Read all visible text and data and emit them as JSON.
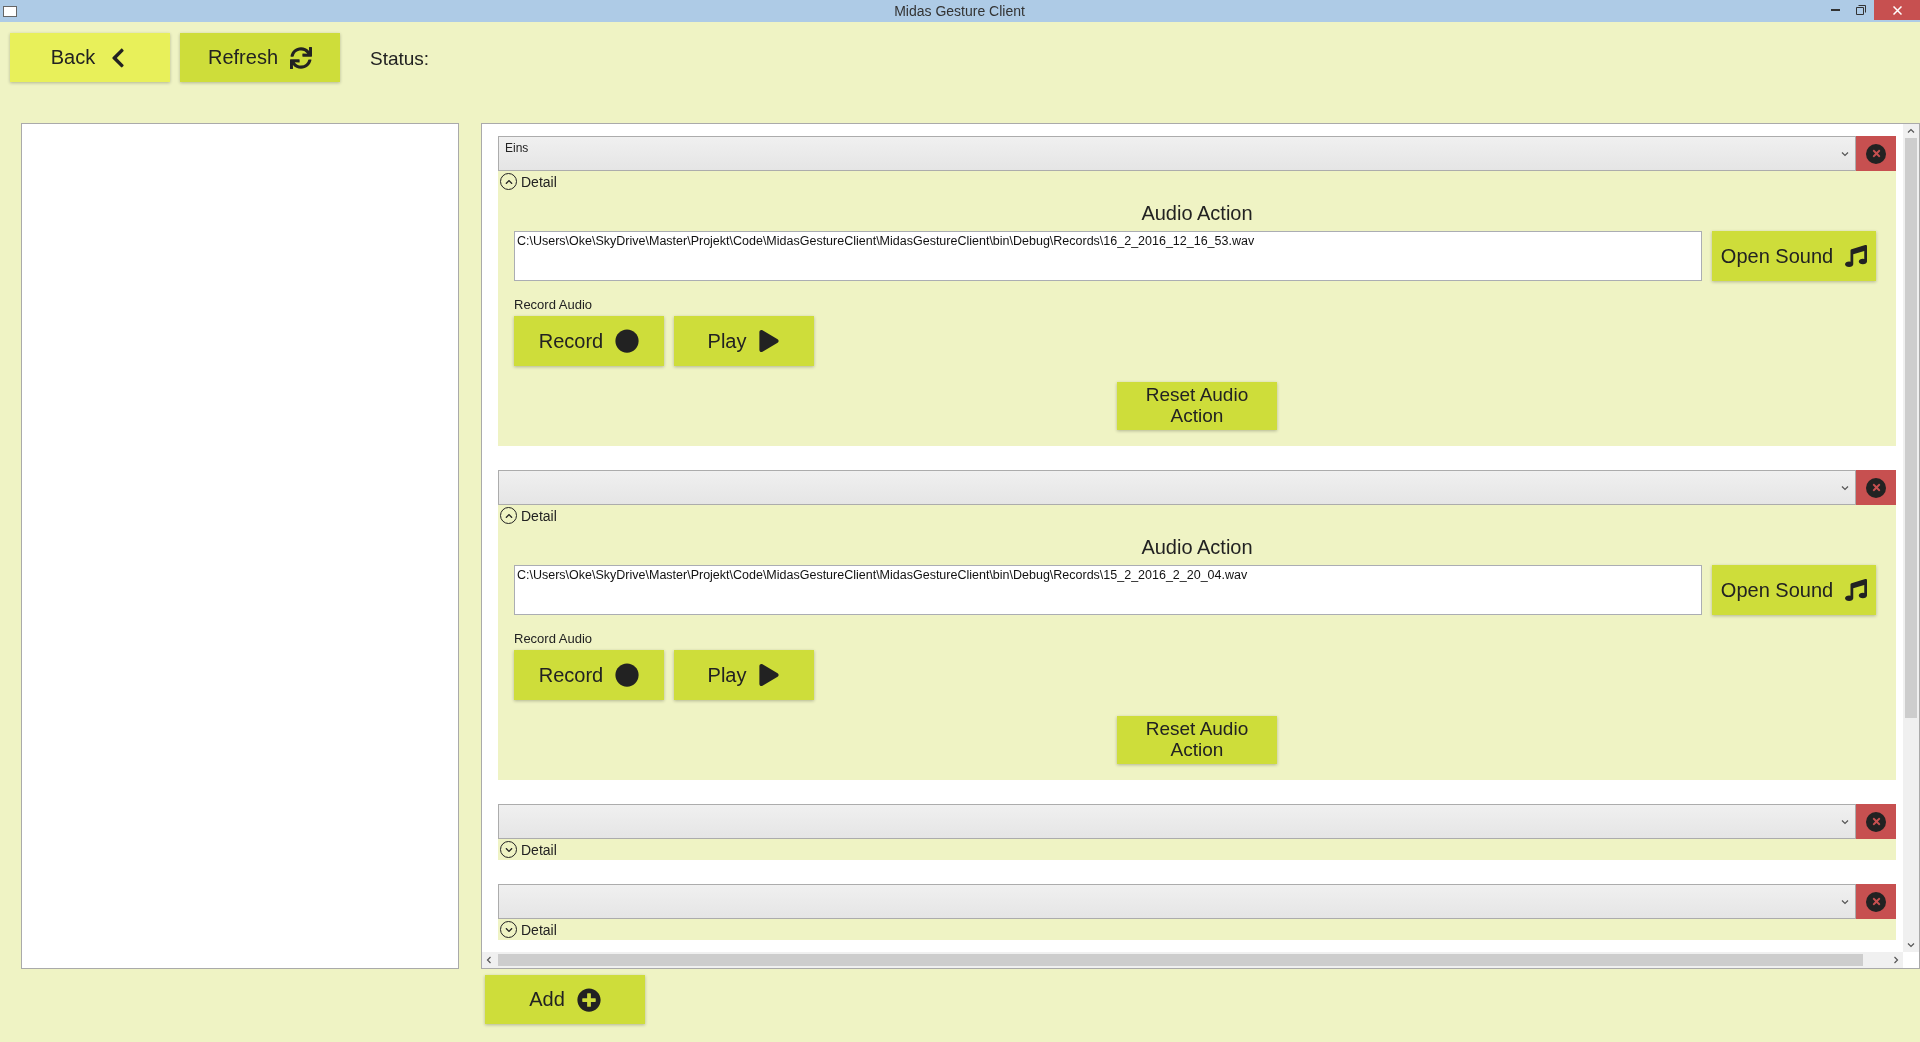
{
  "window": {
    "title": "Midas Gesture Client"
  },
  "toolbar": {
    "buttons": [
      {
        "label": "Back",
        "kind": "back"
      },
      {
        "label": "Refresh",
        "kind": "refresh"
      }
    ],
    "status_label": "Status:"
  },
  "gestures": [
    {
      "value": "Eins",
      "detail_label": "Detail",
      "expanded": true,
      "section_title": "Audio Action",
      "path": "C:\\Users\\Oke\\SkyDrive\\Master\\Projekt\\Code\\MidasGestureClient\\MidasGestureClient\\bin\\Debug\\Records\\16_2_2016_12_16_53.wav",
      "open_label": "Open Sound",
      "record_label": "Record Audio",
      "record_button": "Record",
      "play_button": "Play",
      "reset_button": "Reset Audio Action"
    },
    {
      "detail_label": "Detail",
      "expanded": true,
      "section_title": "Audio Action",
      "path": "C:\\Users\\Oke\\SkyDrive\\Master\\Projekt\\Code\\MidasGestureClient\\MidasGestureClient\\bin\\Debug\\Records\\15_2_2016_2_20_04.wav",
      "open_label": "Open Sound",
      "record_label": "Record Audio",
      "record_button": "Record",
      "play_button": "Play",
      "reset_button": "Reset Audio Action"
    },
    {
      "detail_label": "Detail",
      "expanded": false
    },
    {
      "detail_label": "Detail",
      "expanded": false
    }
  ],
  "add_button": "Add"
}
